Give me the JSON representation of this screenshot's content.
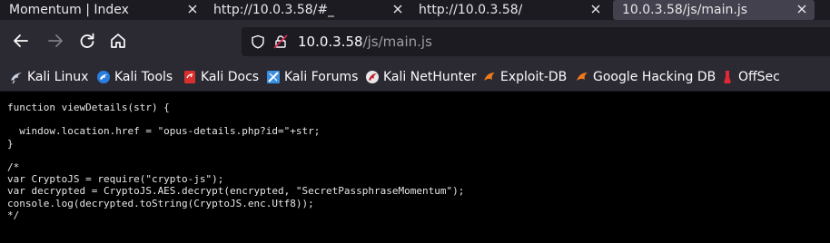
{
  "tabs": [
    {
      "label": "Momentum | Index",
      "active": false
    },
    {
      "label": "http://10.0.3.58/#_",
      "active": false
    },
    {
      "label": "http://10.0.3.58/",
      "active": false
    },
    {
      "label": "10.0.3.58/js/main.js",
      "active": true
    }
  ],
  "url": {
    "host": "10.0.3.58",
    "path": "/js/main.js"
  },
  "bookmarks": [
    {
      "label": "Kali Linux",
      "icon": "kali-dragon-icon"
    },
    {
      "label": "Kali Tools",
      "icon": "kali-tools-icon"
    },
    {
      "label": "Kali Docs",
      "icon": "kali-docs-icon"
    },
    {
      "label": "Kali Forums",
      "icon": "kali-forums-icon"
    },
    {
      "label": "Kali NetHunter",
      "icon": "kali-nethunter-icon"
    },
    {
      "label": "Exploit-DB",
      "icon": "exploit-db-icon"
    },
    {
      "label": "Google Hacking DB",
      "icon": "ghdb-icon"
    },
    {
      "label": "OffSec",
      "icon": "offsec-icon"
    }
  ],
  "code_lines": [
    "function viewDetails(str) {",
    "",
    "  window.location.href = \"opus-details.php?id=\"+str;",
    "}",
    "",
    "/*",
    "var CryptoJS = require(\"crypto-js\");",
    "var decrypted = CryptoJS.AES.decrypt(encrypted, \"SecretPassphraseMomentum\");",
    "console.log(decrypted.toString(CryptoJS.enc.Utf8));",
    "*/"
  ]
}
